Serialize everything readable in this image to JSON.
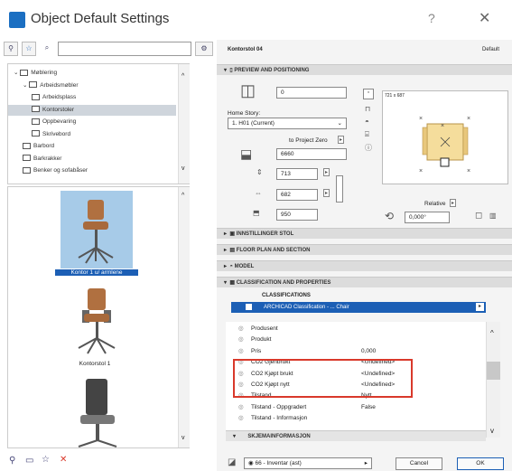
{
  "window": {
    "title": "Object Default Settings",
    "help": "?",
    "close": "✕"
  },
  "left": {
    "tree": [
      {
        "label": "Møblering",
        "level": 0,
        "expanded": true
      },
      {
        "label": "Arbeidsmøbler",
        "level": 1,
        "expanded": true
      },
      {
        "label": "Arbeidsplass",
        "level": 2
      },
      {
        "label": "Kontorstoler",
        "level": 2,
        "selected": true
      },
      {
        "label": "Oppbevaring",
        "level": 2
      },
      {
        "label": "Skrivebord",
        "level": 2
      },
      {
        "label": "Barbord",
        "level": 1
      },
      {
        "label": "Barkrakker",
        "level": 1
      },
      {
        "label": "Benker og sofabåser",
        "level": 1
      }
    ],
    "gallery": [
      {
        "label": "Kontor 1 u/ armlene",
        "selected": true
      },
      {
        "label": "Kontorstol 1",
        "selected": false
      }
    ]
  },
  "right": {
    "object_name": "Kontorstol 04",
    "default_label": "Default",
    "sections": {
      "preview": "PREVIEW AND POSITIONING",
      "innst": "INNSTILLINGER STOL",
      "floor": "FLOOR PLAN AND SECTION",
      "model": "MODEL",
      "class": "CLASSIFICATION AND PROPERTIES"
    },
    "home_story_label": "Home Story:",
    "home_story_value": "1. H01 (Current)",
    "elevation_value": "0",
    "to_project_zero": "to Project Zero",
    "project_zero_value": "6660",
    "dim1": "713",
    "dim2": "682",
    "dim3": "950",
    "preview_caption": "721 x 687",
    "relative_label": "Relative",
    "angle_value": "0,000°",
    "classifications_header": "CLASSIFICATIONS",
    "classification_row": "ARCHICAD Classification - ... Chair",
    "properties": [
      {
        "name": "Produsent",
        "value": ""
      },
      {
        "name": "Produkt",
        "value": ""
      },
      {
        "name": "Pris",
        "value": "0,000"
      },
      {
        "name": "CO2 Gjenbrukt",
        "value": "<Undefined>"
      },
      {
        "name": "CO2 Kjøpt brukt",
        "value": "<Undefined>"
      },
      {
        "name": "CO2 Kjøpt nytt",
        "value": "<Undefined>"
      },
      {
        "name": "Tilstand",
        "value": "Nytt"
      },
      {
        "name": "Tilstand - Oppgradert",
        "value": "False"
      },
      {
        "name": "Tilstand - Informasjon",
        "value": ""
      }
    ],
    "skjema_header": "SKJEMAINFORMASJON",
    "layer_value": "66 - Inventar (ast)",
    "cancel_label": "Cancel",
    "ok_label": "OK"
  },
  "colors": {
    "accent": "#1c5fb5",
    "highlight_box": "#d9392b"
  }
}
